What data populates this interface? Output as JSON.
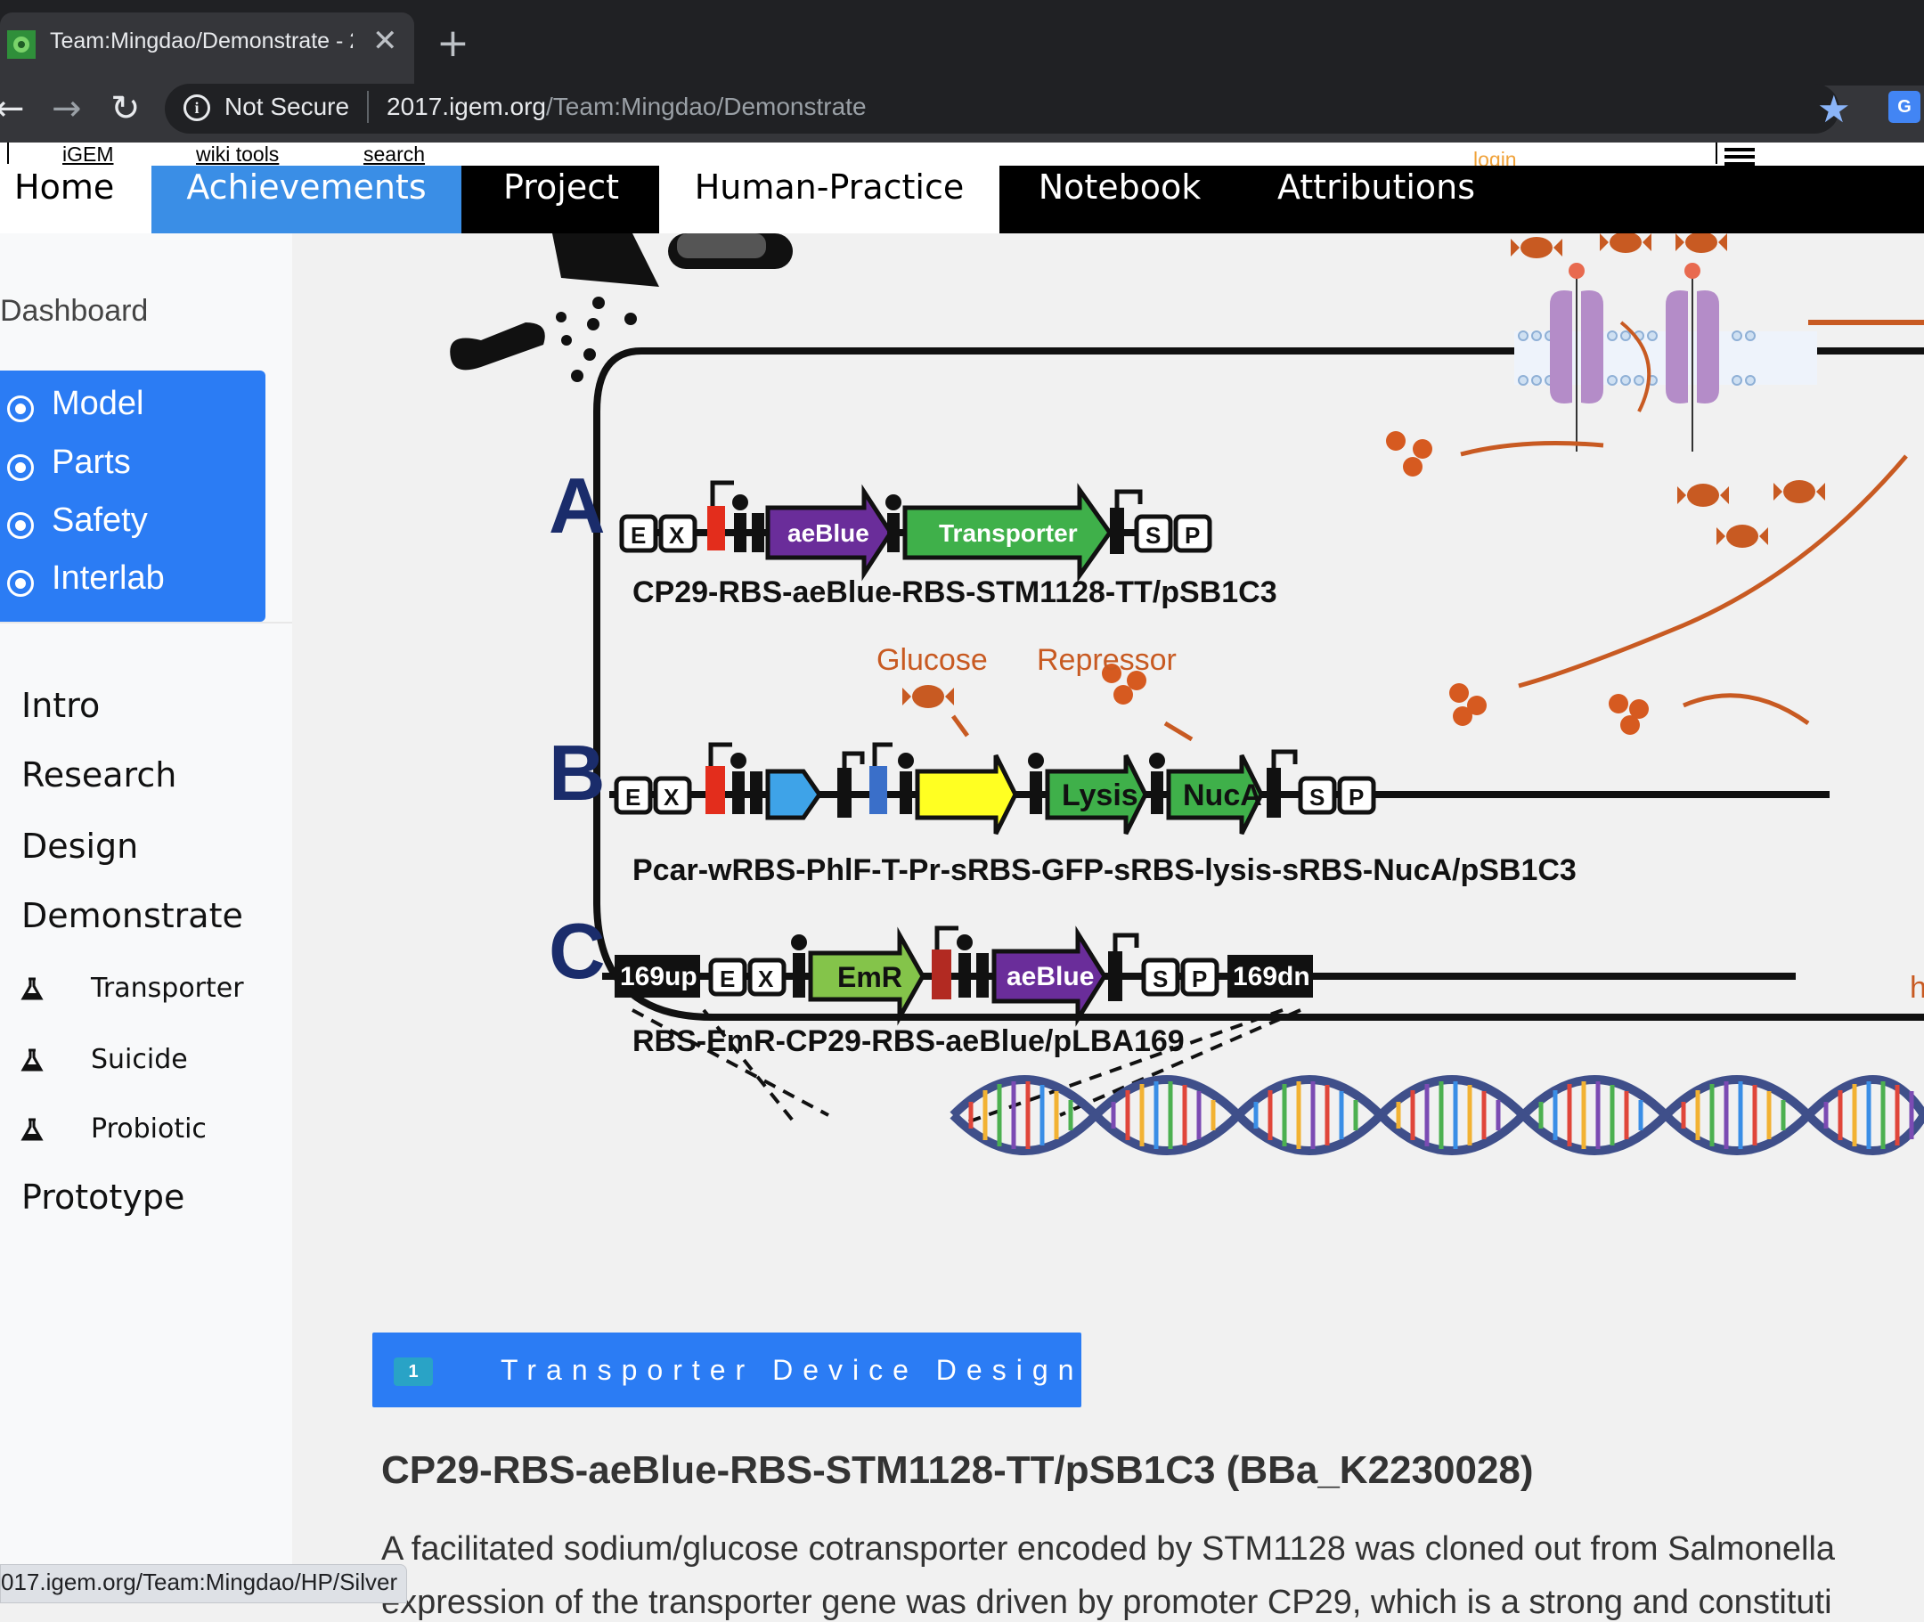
{
  "browser": {
    "tab_title": "Team:Mingdao/Demonstrate - 2",
    "security_label": "Not Secure",
    "url_domain": "2017.igem.org",
    "url_path": "/Team:Mingdao/Demonstrate",
    "status_url": "017.igem.org/Team:Mingdao/HP/Silver"
  },
  "igem_bar": {
    "igem": "iGEM",
    "wiki_tools": "wiki tools",
    "search": "search",
    "login": "login"
  },
  "main_nav": {
    "home": "Home",
    "achievements": "Achievements",
    "project": "Project",
    "human_practice": "Human-Practice",
    "notebook": "Notebook",
    "attributions": "Attributions"
  },
  "sidebar": {
    "dashboard": "Dashboard",
    "blue_items": [
      "Model",
      "Parts",
      "Safety",
      "Interlab"
    ],
    "items": [
      "Intro",
      "Research",
      "Design",
      "Demonstrate"
    ],
    "sub_items": [
      "Transporter",
      "Suicide",
      "Probiotic"
    ],
    "last_item": "Prototype"
  },
  "figure": {
    "label_a": "A",
    "label_b": "B",
    "label_c": "C",
    "a_caption": "CP29-RBS-aeBlue-RBS-STM1128-TT/pSB1C3",
    "b_caption": "Pcar-wRBS-PhlF-T-Pr-sRBS-GFP-sRBS-lysis-sRBS-NucA/pSB1C3",
    "c_caption": "RBS-EmR-CP29-RBS-aeBlue/pLBA169",
    "glucose": "Glucose",
    "repressor": "Repressor",
    "aeblue": "aeBlue",
    "transporter": "Transporter",
    "lysis": "Lysis",
    "nuca": "NucA",
    "emr": "EmR",
    "up169": "169up",
    "dn169": "169dn",
    "e": "E",
    "x": "X",
    "s": "S",
    "p": "P",
    "edge_h": "h"
  },
  "section": {
    "number": "1",
    "title": "Transporter Device Design"
  },
  "content": {
    "heading": "CP29-RBS-aeBlue-RBS-STM1128-TT/pSB1C3 (BBa_K2230028)",
    "para_line1": "A facilitated sodium/glucose cotransporter encoded by STM1128 was cloned out from Salmonella",
    "para_line2": "expression of the transporter gene was driven by promoter CP29, which is a strong and constituti"
  },
  "colors": {
    "accent_blue": "#2b7cf4",
    "nav_blue": "#3a8ee6",
    "badge_teal": "#29a3c6",
    "candy_orange": "#c85a22",
    "membrane_purple": "#b48cc8"
  }
}
